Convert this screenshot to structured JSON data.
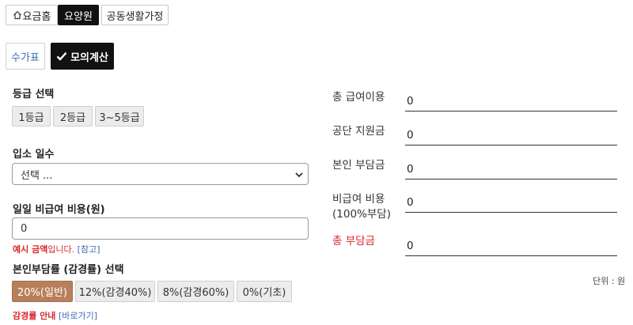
{
  "top_tabs": [
    {
      "label": "요금홈",
      "icon": "home-icon"
    },
    {
      "label": "요양원"
    },
    {
      "label": "공동생활가정"
    }
  ],
  "sub_tabs": [
    {
      "label": "수가표"
    },
    {
      "label": "모의계산",
      "icon": "check-icon"
    }
  ],
  "grade": {
    "label": "등급 선택",
    "options": [
      "1등급",
      "2등급",
      "3~5등급"
    ]
  },
  "days": {
    "label": "입소 일수",
    "selected": "선택 ..."
  },
  "noncovered": {
    "label": "일일 비급여 비용(원)",
    "value": "0",
    "note_red": "예시 금액",
    "note_suffix": "입니다.",
    "note_link": "[참고]"
  },
  "copay_rate": {
    "label": "본인부담률 (감경률) 선택",
    "options": [
      "20%(일반)",
      "12%(감경40%)",
      "8%(감경60%)",
      "0%(기초)"
    ],
    "selected_index": 0,
    "note_red": "감경률 안내",
    "note_link": "[바로가기]"
  },
  "results": [
    {
      "label": "총 급여이용",
      "value": "0"
    },
    {
      "label": "공단 지원금",
      "value": "0"
    },
    {
      "label": "본인 부담금",
      "value": "0"
    },
    {
      "label": "비급여 비용",
      "label2": "(100%부담)",
      "value": "0"
    },
    {
      "label": "총 부담금",
      "value": "0"
    }
  ],
  "unit": "단위 : 원",
  "colors": {
    "accent_red": "#d9262b",
    "active_brown": "#b7805a",
    "dark": "#111111",
    "link_blue": "#3b6bb5"
  }
}
